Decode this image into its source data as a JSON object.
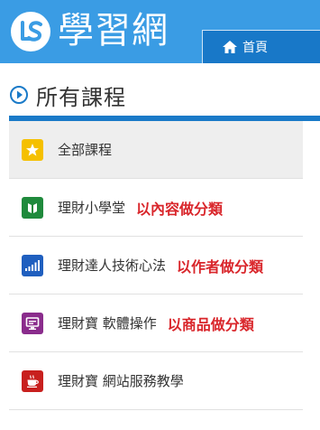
{
  "header": {
    "logo_text": "學習網",
    "home_label": "首頁"
  },
  "section": {
    "title": "所有課程"
  },
  "categories": [
    {
      "label": "全部課程",
      "note": "",
      "icon": "star-icon",
      "color": "#f5c000"
    },
    {
      "label": "理財小學堂",
      "note": "以內容做分類",
      "icon": "book-icon",
      "color": "#1f8a3c"
    },
    {
      "label": "理財達人技術心法",
      "note": "以作者做分類",
      "icon": "signal-bars-icon",
      "color": "#1f5fbf"
    },
    {
      "label": "理財寶 軟體操作",
      "note": "以商品做分類",
      "icon": "monitor-icon",
      "color": "#8a2c8c"
    },
    {
      "label": "理財寶 網站服務教學",
      "note": "",
      "icon": "coffee-cup-icon",
      "color": "#c8201e"
    }
  ],
  "colors": {
    "header_bg": "#3a9ce4",
    "home_tab_bg": "#1878c8",
    "note_text": "#d9262b"
  }
}
